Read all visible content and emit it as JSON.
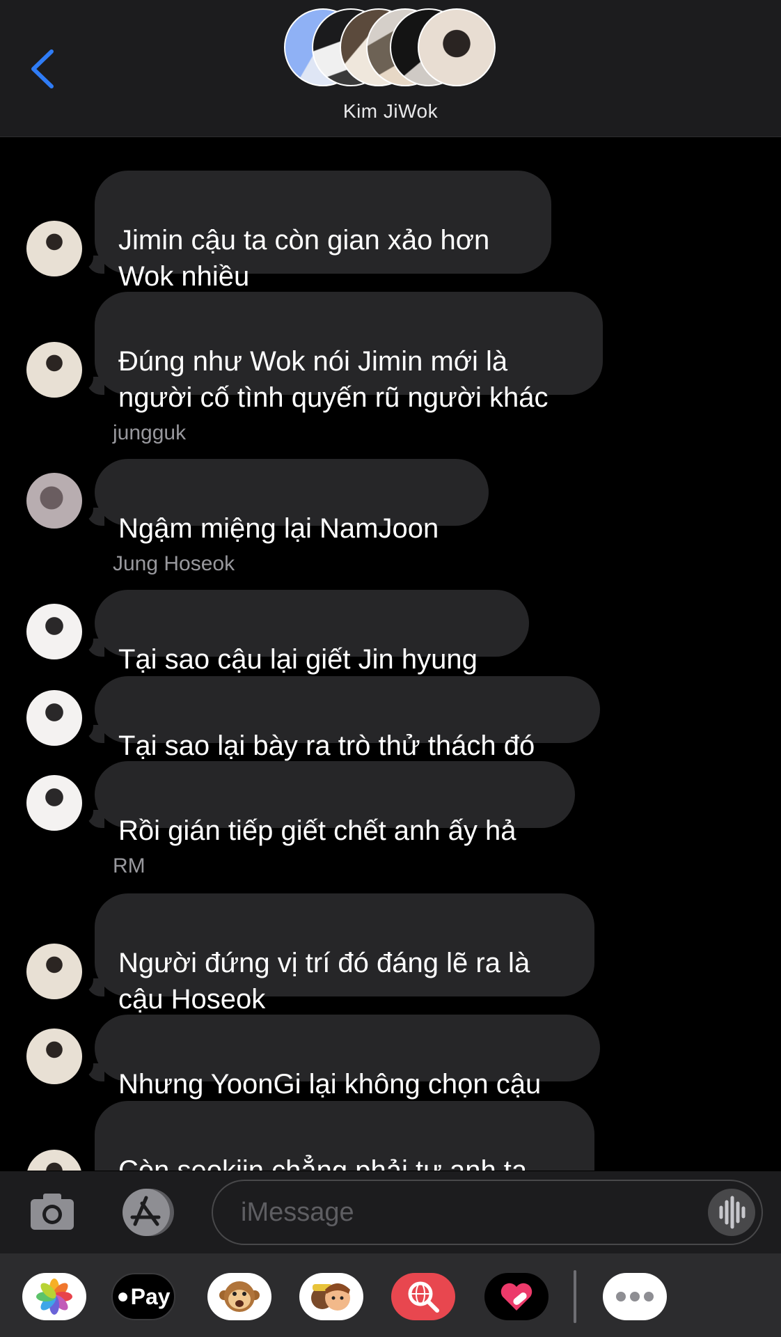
{
  "header": {
    "title": "Kim JiWok",
    "back_icon": "chevron-left-icon",
    "accent_color": "#2f7cf6"
  },
  "messages": [
    {
      "sender": "",
      "text": "Jimin cậu ta còn gian xảo hơn\nWok nhiều",
      "avatar": "namjoon-avatar"
    },
    {
      "sender": "",
      "text": "Đúng như Wok nói Jimin mới là\nngười cố tình quyến rũ người khác",
      "avatar": "namjoon-avatar"
    },
    {
      "sender": "jungguk",
      "text": "Ngậm miệng lại NamJoon",
      "avatar": "jungguk-avatar"
    },
    {
      "sender": "Jung Hoseok",
      "text": "Tại sao cậu lại giết Jin hyung",
      "avatar": "hoseok-avatar"
    },
    {
      "sender": "",
      "text": "Tại sao lại bày ra trò thử thách đó",
      "avatar": "hoseok-avatar"
    },
    {
      "sender": "",
      "text": "Rồi gián tiếp giết chết anh ấy hả",
      "avatar": "hoseok-avatar"
    },
    {
      "sender": "RM",
      "text": "Người đứng vị trí đó đáng lẽ ra là\ncậu Hoseok",
      "avatar": "namjoon-avatar"
    },
    {
      "sender": "",
      "text": "Nhưng YoonGi lại không chọn cậu",
      "avatar": "namjoon-avatar"
    },
    {
      "sender": "",
      "text": "Còn seokjin chẳng phải tự anh ta\nđâm đầu vào chỗ chết sao",
      "avatar": "namjoon-avatar"
    }
  ],
  "input": {
    "placeholder": "iMessage",
    "camera_icon": "camera-icon",
    "apps_icon": "app-store-icon",
    "audio_icon": "audio-waveform-icon"
  },
  "apps": {
    "photos": "photos-app-icon",
    "applepay_label": "Pay",
    "animoji": "animoji-monkey-icon",
    "memoji": "memoji-stickers-icon",
    "search": "images-search-icon",
    "digital_touch": "digital-touch-heart-icon",
    "more": "more-apps-icon"
  },
  "colors": {
    "bubble": "#262628",
    "bar": "#1c1c1e",
    "drawer": "#2c2c2e",
    "sender_label": "#98989d"
  }
}
